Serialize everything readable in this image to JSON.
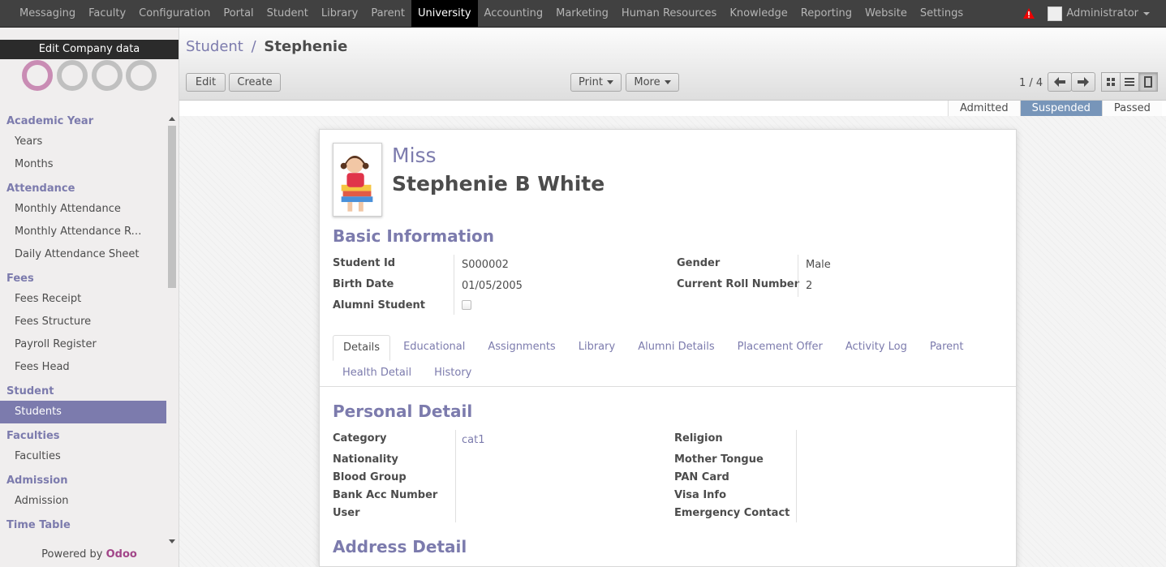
{
  "topmenu": {
    "items": [
      "Messaging",
      "Faculty",
      "Configuration",
      "Portal",
      "Student",
      "Library",
      "Parent",
      "University",
      "Accounting",
      "Marketing",
      "Human Resources",
      "Knowledge",
      "Reporting",
      "Website",
      "Settings"
    ],
    "active": "University",
    "user": "Administrator"
  },
  "sidebar": {
    "edit_company": "Edit Company data",
    "sections": [
      {
        "label": "Academic Year",
        "items": [
          "Years",
          "Months"
        ]
      },
      {
        "label": "Attendance",
        "items": [
          "Monthly Attendance",
          "Monthly Attendance Re...",
          "Daily Attendance Sheet"
        ]
      },
      {
        "label": "Fees",
        "items": [
          "Fees Receipt",
          "Fees Structure",
          "Payroll Register",
          "Fees Head"
        ]
      },
      {
        "label": "Student",
        "items": [
          "Students"
        ]
      },
      {
        "label": "Faculties",
        "items": [
          "Faculties"
        ]
      },
      {
        "label": "Admission",
        "items": [
          "Admission"
        ]
      },
      {
        "label": "Time Table",
        "items": []
      }
    ],
    "active_item": "Students",
    "powered_prefix": "Powered by",
    "powered_brand": "Odoo"
  },
  "breadcrumb": {
    "parent": "Student",
    "sep": "/",
    "current": "Stephenie"
  },
  "buttons": {
    "edit": "Edit",
    "create": "Create",
    "print": "Print",
    "more": "More"
  },
  "pager": "1 / 4",
  "status": {
    "stages": [
      "Admitted",
      "Suspended",
      "Passed"
    ],
    "active": "Suspended"
  },
  "record": {
    "title": "Miss",
    "name": "Stephenie B  White",
    "basic_info_title": "Basic Information",
    "student_id_label": "Student Id",
    "student_id": "S000002",
    "birth_date_label": "Birth Date",
    "birth_date": "01/05/2005",
    "alumni_label": "Alumni Student",
    "alumni_checked": false,
    "gender_label": "Gender",
    "gender": "Male",
    "roll_label": "Current Roll Number",
    "roll": "2"
  },
  "tabs": {
    "row1": [
      "Details",
      "Educational",
      "Assignments",
      "Library",
      "Alumni Details",
      "Placement Offer",
      "Activity Log",
      "Parent"
    ],
    "row2": [
      "Health Detail",
      "History"
    ],
    "active": "Details"
  },
  "personal": {
    "title": "Personal Detail",
    "left": [
      {
        "label": "Category",
        "value": "cat1"
      },
      {
        "label": "Nationality",
        "value": ""
      },
      {
        "label": "Blood Group",
        "value": ""
      },
      {
        "label": "Bank Acc Number",
        "value": ""
      },
      {
        "label": "User",
        "value": ""
      }
    ],
    "right": [
      {
        "label": "Religion",
        "value": ""
      },
      {
        "label": "Mother Tongue",
        "value": ""
      },
      {
        "label": "PAN Card",
        "value": ""
      },
      {
        "label": "Visa Info",
        "value": ""
      },
      {
        "label": "Emergency Contact",
        "value": ""
      }
    ]
  },
  "address": {
    "title": "Address Detail"
  },
  "colors": {
    "brand": "#7c7bad",
    "topbar": "#414141",
    "active_stage": "#7795b9",
    "odoo": "#a24689"
  }
}
